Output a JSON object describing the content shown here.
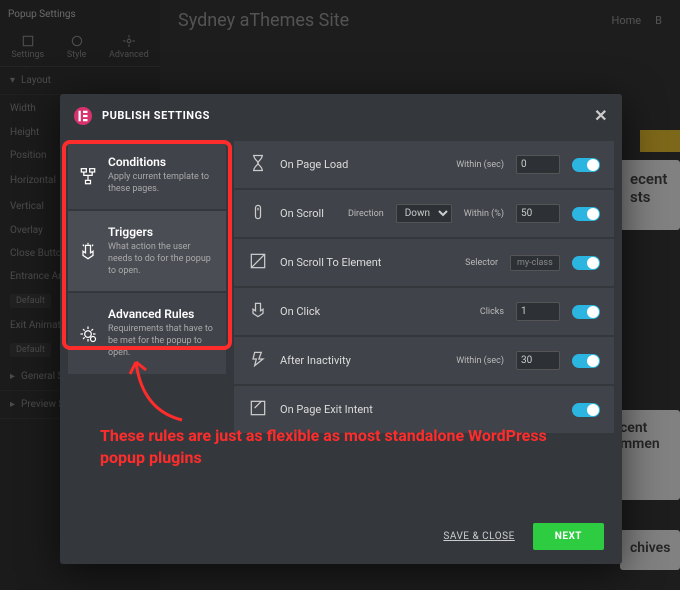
{
  "bg": {
    "sidebar_title": "Popup Settings",
    "tabs": [
      "Settings",
      "Style",
      "Advanced"
    ],
    "layout_label": "Layout",
    "rows": [
      "Width",
      "Height",
      "Position",
      "Horizontal",
      "Vertical",
      "Overlay",
      "Close Button",
      "Entrance Anim",
      "Exit Animation"
    ],
    "defaults": "Default",
    "preview": "Preview Se",
    "general": "General Se",
    "site_title": "Sydney aThemes Site",
    "nav": [
      "Home",
      "B"
    ],
    "card1": "ecent sts",
    "card2": "cent mmen",
    "card3": "chives"
  },
  "modal": {
    "title": "PUBLISH SETTINGS",
    "left": [
      {
        "title": "Conditions",
        "desc": "Apply current template to these pages."
      },
      {
        "title": "Triggers",
        "desc": "What action the user needs to do for the popup to open."
      },
      {
        "title": "Advanced Rules",
        "desc": "Requirements that have to be met for the popup to open."
      }
    ],
    "triggers": {
      "page_load": {
        "name": "On Page Load",
        "param": "Within (sec)",
        "value": "0"
      },
      "scroll": {
        "name": "On Scroll",
        "dir_label": "Direction",
        "dir": "Down",
        "param": "Within (%)",
        "value": "50"
      },
      "scroll_el": {
        "name": "On Scroll To Element",
        "param": "Selector",
        "value": "my-class"
      },
      "click": {
        "name": "On Click",
        "param": "Clicks",
        "value": "1"
      },
      "inactivity": {
        "name": "After Inactivity",
        "param": "Within (sec)",
        "value": "30"
      },
      "exit": {
        "name": "On Page Exit Intent"
      }
    },
    "save": "SAVE & CLOSE",
    "next": "NEXT"
  },
  "annotation": "These rules are just as flexible as most standalone WordPress popup plugins"
}
